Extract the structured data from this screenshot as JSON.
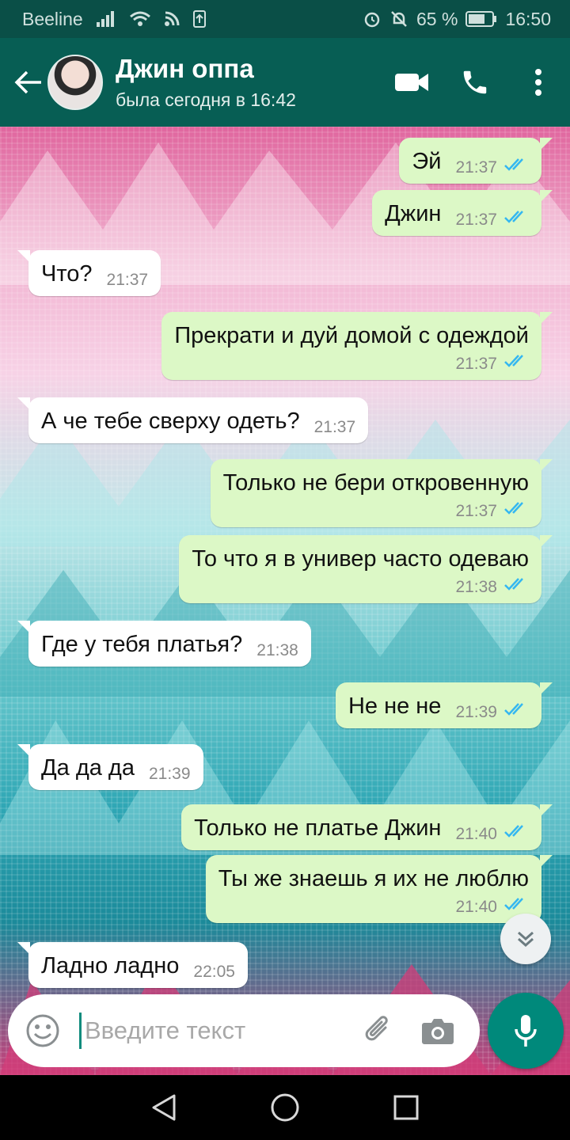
{
  "status_bar": {
    "carrier": "Beeline",
    "battery": "65 %",
    "time": "16:50"
  },
  "header": {
    "contact_name": "Джин оппа",
    "last_seen": "была сегодня в 16:42"
  },
  "messages": [
    {
      "direction": "out",
      "text": "Эй",
      "time": "21:37",
      "read": true
    },
    {
      "direction": "out",
      "text": "Джин",
      "time": "21:37",
      "read": true
    },
    {
      "direction": "in",
      "text": "Что?",
      "time": "21:37"
    },
    {
      "direction": "out",
      "text": "Прекрати и дуй домой с одеждой",
      "time": "21:37",
      "read": true
    },
    {
      "direction": "in",
      "text": "А че тебе сверху одеть?",
      "time": "21:37"
    },
    {
      "direction": "out",
      "text": "Только не бери откровенную",
      "time": "21:37",
      "read": true
    },
    {
      "direction": "out",
      "text": "То что я в универ часто одеваю",
      "time": "21:38",
      "read": true
    },
    {
      "direction": "in",
      "text": "Где у тебя платья?",
      "time": "21:38"
    },
    {
      "direction": "out",
      "text": "Не не не",
      "time": "21:39",
      "read": true
    },
    {
      "direction": "in",
      "text": "Да да да",
      "time": "21:39"
    },
    {
      "direction": "out",
      "text": "Только не платье Джин",
      "time": "21:40",
      "read": true
    },
    {
      "direction": "out",
      "text": "Ты же знаешь я их не люблю",
      "time": "21:40",
      "read": true
    },
    {
      "direction": "in",
      "text": "Ладно ладно",
      "time": "22:05"
    }
  ],
  "input": {
    "placeholder": "Введите текст",
    "value": ""
  },
  "colors": {
    "header": "#075e54",
    "outgoing_bubble": "#dcf8c6",
    "incoming_bubble": "#ffffff",
    "read_ticks": "#34b7f1",
    "mic_button": "#00897b"
  },
  "icons": {
    "back": "arrow-left-icon",
    "video": "video-camera-icon",
    "call": "phone-icon",
    "menu": "more-vertical-icon",
    "emoji": "smiley-icon",
    "attach": "paperclip-icon",
    "camera": "camera-icon",
    "mic": "microphone-icon",
    "scroll": "double-chevron-down-icon"
  }
}
